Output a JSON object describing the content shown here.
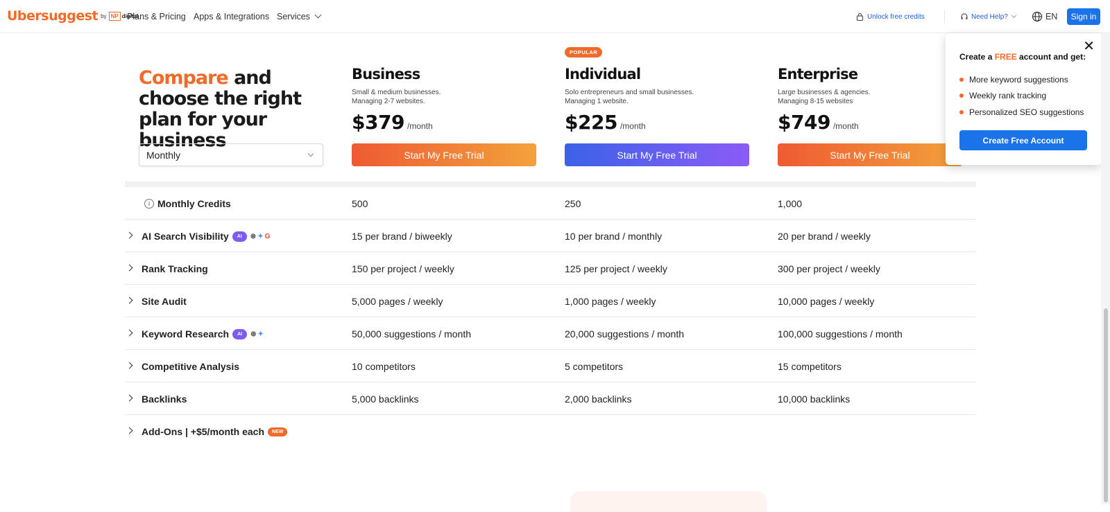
{
  "header": {
    "logo_text": "Ubersuggest",
    "logo_by": "by",
    "logo_np": "NP",
    "logo_digital": "digital",
    "nav": [
      "Plans & Pricing",
      "Apps & Integrations",
      "Services"
    ],
    "unlock_credits": "Unlock free credits",
    "need_help": "Need Help?",
    "language": "EN",
    "sign_in": "Sign in"
  },
  "hero": {
    "accent": "Compare",
    "rest": " and choose the right plan for your business"
  },
  "billing": {
    "selected": "Monthly"
  },
  "plans": [
    {
      "name": "Business",
      "badge": "",
      "desc1": "Small & medium businesses.",
      "desc2": "Managing 2-7 websites.",
      "price": "$379",
      "per": "/month",
      "cta": "Start My Free Trial"
    },
    {
      "name": "Individual",
      "badge": "POPULAR",
      "desc1": "Solo entrepreneurs and small businesses.",
      "desc2": "Managing 1 website.",
      "price": "$225",
      "per": "/month",
      "cta": "Start My Free Trial"
    },
    {
      "name": "Enterprise",
      "badge": "",
      "desc1": "Large businesses & agencies.",
      "desc2": "Managing 8-15 websites",
      "price": "$749",
      "per": "/month",
      "cta": "Start My Free Trial"
    }
  ],
  "features": [
    {
      "name": "Monthly Credits",
      "values": [
        "500",
        "250",
        "1,000"
      ]
    },
    {
      "name": "AI Search Visibility",
      "ai_badge": "AI",
      "values": [
        "15 per brand / biweekly",
        "10 per brand / monthly",
        "20 per brand / weekly"
      ]
    },
    {
      "name": "Rank Tracking",
      "values": [
        "150 per project / weekly",
        "125 per project / weekly",
        "300 per project / weekly"
      ]
    },
    {
      "name": "Site Audit",
      "values": [
        "5,000 pages / weekly",
        "1,000 pages / weekly",
        "10,000 pages / weekly"
      ]
    },
    {
      "name": "Keyword Research",
      "ai_badge": "AI",
      "values": [
        "50,000 suggestions / month",
        "20,000 suggestions / month",
        "100,000 suggestions / month"
      ]
    },
    {
      "name": "Competitive Analysis",
      "values": [
        "10 competitors",
        "5 competitors",
        "15 competitors"
      ]
    },
    {
      "name": "Backlinks",
      "values": [
        "5,000 backlinks",
        "2,000 backlinks",
        "10,000 backlinks"
      ]
    },
    {
      "name": "Add-Ons | +$5/month each",
      "new_badge": "NEW",
      "values": [
        "",
        "",
        ""
      ]
    }
  ],
  "popup": {
    "title_pre": "Create a ",
    "title_free": "FREE",
    "title_post": " account and get:",
    "items": [
      "More keyword suggestions",
      "Weekly rank tracking",
      "Personalized SEO suggestions"
    ],
    "cta": "Create Free Account"
  },
  "colors": {
    "accent": "#f26a2a",
    "primary": "#1a73e8",
    "purple": "#7c5cf0"
  }
}
